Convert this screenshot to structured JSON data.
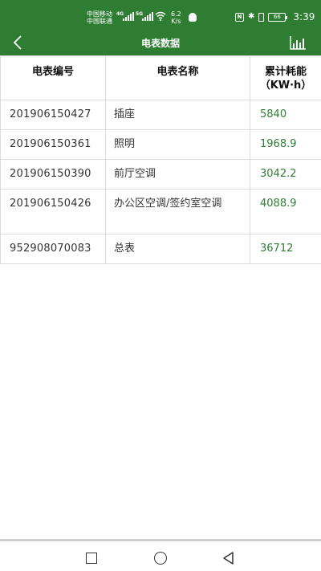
{
  "status_bar": {
    "carrier_1": "中国移动",
    "carrier_2": "中国联通",
    "net_1": "4G",
    "net_2": "5G",
    "speed_value": "6.2",
    "speed_unit": "K/s",
    "nfc_label": "N",
    "battery_level": "66",
    "time": "3:39"
  },
  "header": {
    "title": "电表数据",
    "back_icon": "chevron-left-icon",
    "chart_icon": "bar-chart-icon"
  },
  "table": {
    "headers": {
      "meter_id": "电表编号",
      "meter_name": "电表名称",
      "consumption_line1": "累计耗能",
      "consumption_line2": "（KW·h）"
    },
    "rows": [
      {
        "id": "201906150427",
        "name": "插座",
        "value": "5840"
      },
      {
        "id": "201906150361",
        "name": "照明",
        "value": "1968.9"
      },
      {
        "id": "201906150390",
        "name": "前厅空调",
        "value": "3042.2"
      },
      {
        "id": "201906150426",
        "name": "办公区空调/签约室空调",
        "value": "4088.9"
      },
      {
        "id": "952908070083",
        "name": "总表",
        "value": "36712"
      }
    ]
  },
  "colors": {
    "brand_green": "#2e7d32",
    "value_green": "#2e7d32",
    "border": "#dcdcdc"
  }
}
